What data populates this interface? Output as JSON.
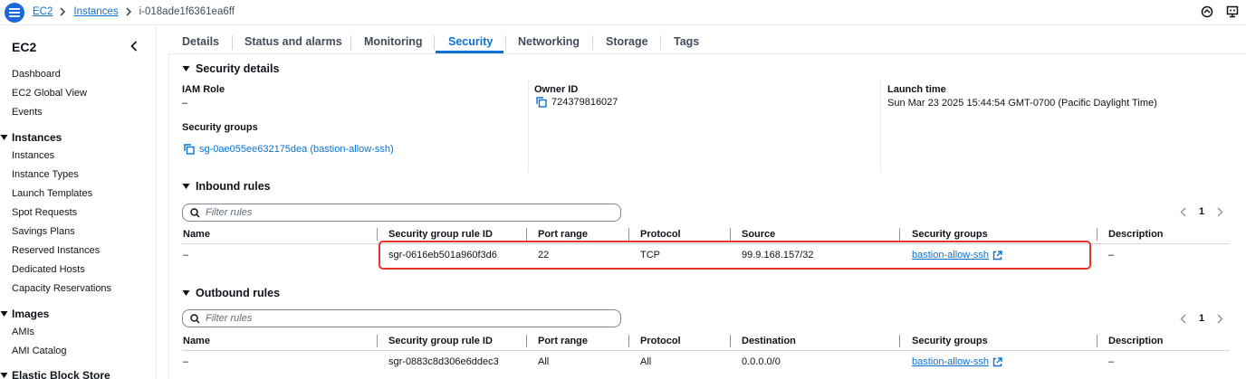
{
  "breadcrumb": {
    "root": "EC2",
    "section": "Instances",
    "current": "i-018ade1f6361ea6ff"
  },
  "sidebar": {
    "title": "EC2",
    "top_items": [
      "Dashboard",
      "EC2 Global View",
      "Events"
    ],
    "instances_section": "Instances",
    "instances_items": [
      "Instances",
      "Instance Types",
      "Launch Templates",
      "Spot Requests",
      "Savings Plans",
      "Reserved Instances",
      "Dedicated Hosts",
      "Capacity Reservations"
    ],
    "images_section": "Images",
    "images_items": [
      "AMIs",
      "AMI Catalog"
    ],
    "ebs_section": "Elastic Block Store"
  },
  "tabs": [
    "Details",
    "Status and alarms",
    "Monitoring",
    "Security",
    "Networking",
    "Storage",
    "Tags"
  ],
  "active_tab": "Security",
  "security_details": {
    "heading": "Security details",
    "iam_role_label": "IAM Role",
    "iam_role_value": "–",
    "owner_id_label": "Owner ID",
    "owner_id_value": "724379816027",
    "launch_time_label": "Launch time",
    "launch_time_value": "Sun Mar 23 2025 15:44:54 GMT-0700 (Pacific Daylight Time)",
    "security_groups_label": "Security groups",
    "security_groups_value": "sg-0ae055ee632175dea (bastion-allow-ssh)"
  },
  "inbound": {
    "heading": "Inbound rules",
    "filter_placeholder": "Filter rules",
    "page": "1",
    "columns": [
      "Name",
      "Security group rule ID",
      "Port range",
      "Protocol",
      "Source",
      "Security groups",
      "Description"
    ],
    "row": {
      "name": "–",
      "rule_id": "sgr-0616eb501a960f3d6",
      "port_range": "22",
      "protocol": "TCP",
      "source": "99.9.168.157/32",
      "security_group": "bastion-allow-ssh",
      "description": "–"
    }
  },
  "outbound": {
    "heading": "Outbound rules",
    "filter_placeholder": "Filter rules",
    "page": "1",
    "columns": [
      "Name",
      "Security group rule ID",
      "Port range",
      "Protocol",
      "Destination",
      "Security groups",
      "Description"
    ],
    "row": {
      "name": "–",
      "rule_id": "sgr-0883c8d306e6ddec3",
      "port_range": "All",
      "protocol": "All",
      "destination": "0.0.0.0/0",
      "security_group": "bastion-allow-ssh",
      "description": "–"
    }
  },
  "colors": {
    "accent": "#0972d3",
    "highlight": "#e8322c",
    "menu_button": "#1b68d8"
  }
}
